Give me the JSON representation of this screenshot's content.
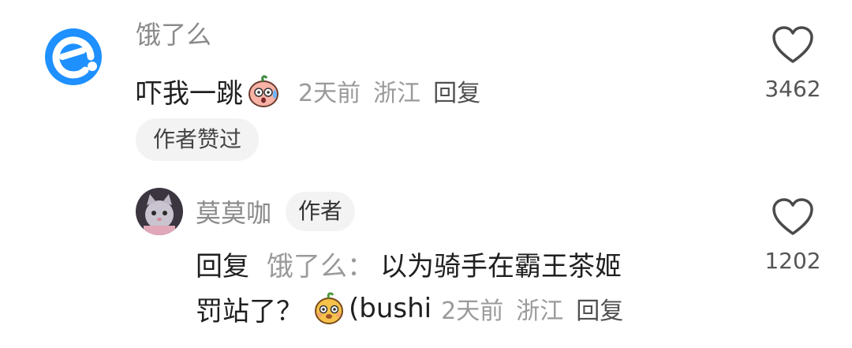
{
  "comment": {
    "username": "饿了么",
    "text": "吓我一跳",
    "time": "2天前",
    "location": "浙江",
    "reply_label": "回复",
    "author_liked_label": "作者赞过",
    "like_count": "3462",
    "emoji_icon": "shocked-peach-emoji-icon",
    "avatar_icon": "eleme-logo-icon",
    "avatar_color": "#1E90FF"
  },
  "reply": {
    "username": "莫莫咖",
    "author_tag": "作者",
    "prefix": "回复",
    "reply_to": "饿了么：",
    "text_line1": "以为骑手在霸王茶姬",
    "text_line2": "罚站了？",
    "text_tail": "(bushi",
    "time": "2天前",
    "location": "浙江",
    "reply_label": "回复",
    "like_count": "1202",
    "emoji_icon": "peach-face-emoji-icon",
    "avatar_icon": "cat-plush-avatar-icon"
  }
}
